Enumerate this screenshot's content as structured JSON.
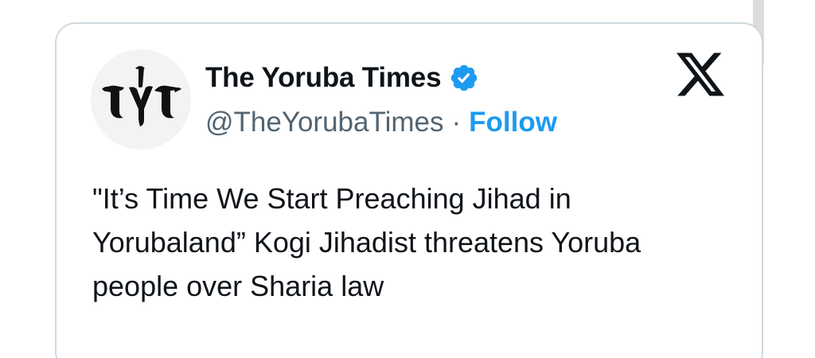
{
  "tweet": {
    "avatar_monogram": "TYT",
    "display_name": "The Yoruba Times",
    "verified": true,
    "handle": "@TheYorubaTimes",
    "separator": "·",
    "follow_label": "Follow",
    "text": "\"It’s Time We Start Preaching Jihad in Yorubaland” Kogi Jihadist threatens Yoruba people over Sharia law"
  },
  "icons": {
    "verified": "verified-badge-icon",
    "brand": "x-logo-icon"
  },
  "colors": {
    "accent": "#1d9bf0",
    "text_primary": "#0f1419",
    "text_secondary": "#536471",
    "card_border": "#cfd9de"
  }
}
